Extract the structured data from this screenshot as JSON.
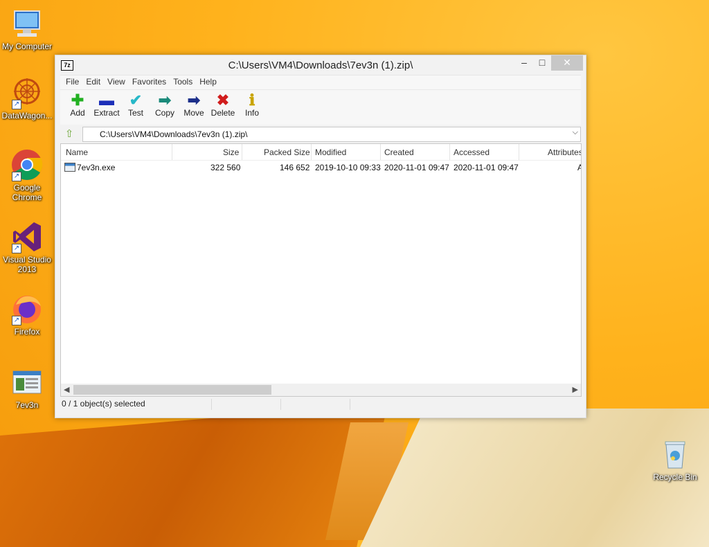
{
  "desktop": {
    "icons": [
      {
        "label": "My Computer",
        "icon": "computer-icon"
      },
      {
        "label": "DataWagon...",
        "icon": "datawagon-icon"
      },
      {
        "label": "Google Chrome",
        "icon": "chrome-icon"
      },
      {
        "label": "Visual Studio 2013",
        "icon": "visual-studio-icon"
      },
      {
        "label": "Firefox",
        "icon": "firefox-icon"
      },
      {
        "label": "7ev3n",
        "icon": "file-icon"
      },
      {
        "label": "Recycle Bin",
        "icon": "recycle-bin-icon"
      }
    ]
  },
  "window": {
    "app_icon": "7z",
    "title": "C:\\Users\\VM4\\Downloads\\7ev3n (1).zip\\",
    "minimize": "–",
    "maximize": "□",
    "close": "✕"
  },
  "menu": [
    "File",
    "Edit",
    "View",
    "Favorites",
    "Tools",
    "Help"
  ],
  "toolbar": [
    {
      "label": "Add",
      "icon": "plus-icon",
      "glyph": "✚",
      "color": "#21b021"
    },
    {
      "label": "Extract",
      "icon": "minus-icon",
      "glyph": "▬",
      "color": "#1c2fb8"
    },
    {
      "label": "Test",
      "icon": "check-icon",
      "glyph": "✔",
      "color": "#27b8c8"
    },
    {
      "label": "Copy",
      "icon": "copy-arrow-icon",
      "glyph": "➡",
      "color": "#1a8a7a"
    },
    {
      "label": "Move",
      "icon": "move-arrow-icon",
      "glyph": "➡",
      "color": "#1c2f8a"
    },
    {
      "label": "Delete",
      "icon": "delete-x-icon",
      "glyph": "✖",
      "color": "#d11d1d"
    },
    {
      "label": "Info",
      "icon": "info-icon",
      "glyph": "ℹ",
      "color": "#c9a400"
    }
  ],
  "address": {
    "path": "C:\\Users\\VM4\\Downloads\\7ev3n (1).zip\\"
  },
  "columns": [
    "Name",
    "Size",
    "Packed Size",
    "Modified",
    "Created",
    "Accessed",
    "Attributes"
  ],
  "files": [
    {
      "name": "7ev3n.exe",
      "size": "322 560",
      "packed_size": "146 652",
      "modified": "2019-10-10 09:33",
      "created": "2020-11-01 09:47",
      "accessed": "2020-11-01 09:47",
      "attributes": "A"
    }
  ],
  "status": {
    "selection": "0 / 1 object(s) selected",
    "cell2": "",
    "cell3": "",
    "cell4": ""
  }
}
